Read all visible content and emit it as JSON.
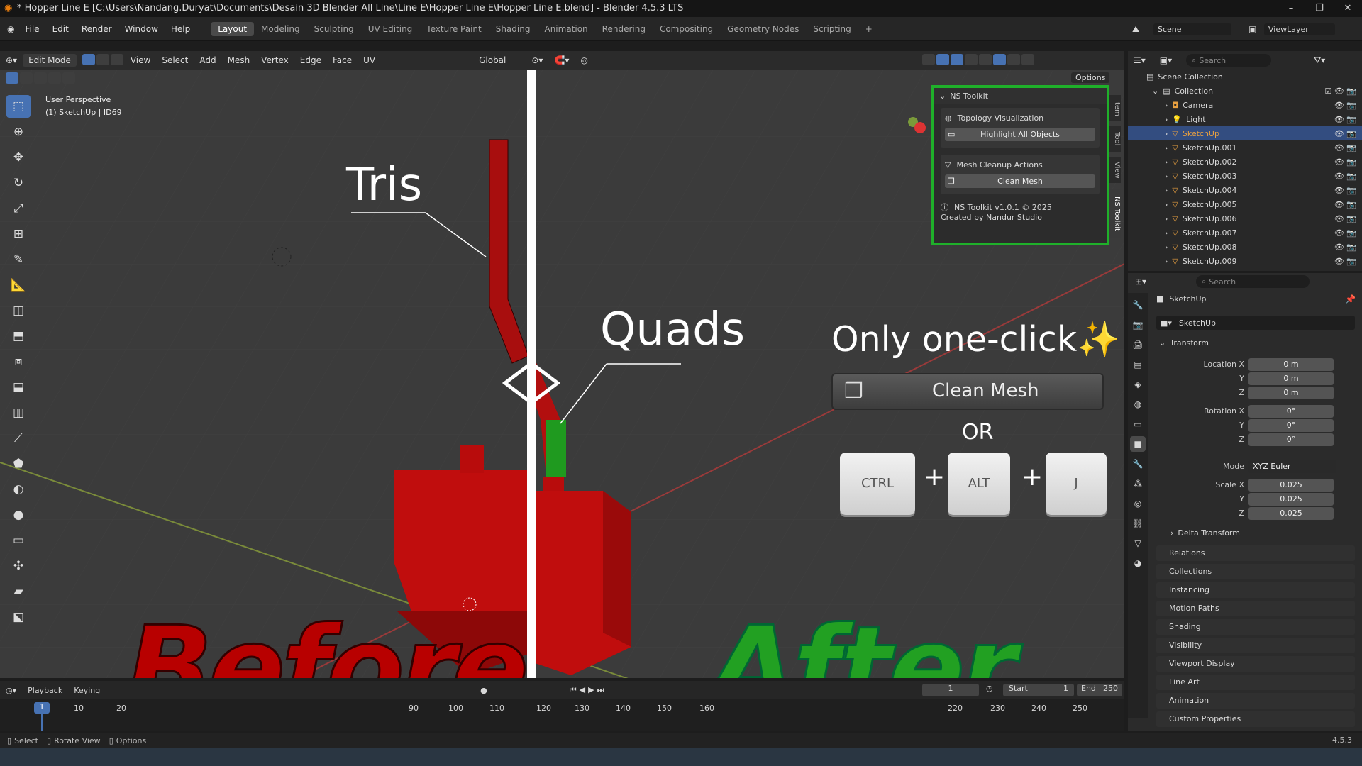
{
  "window": {
    "title": "* Hopper Line E [C:\\Users\\Nandang.Duryat\\Documents\\Desain 3D Blender All Line\\Line E\\Hopper Line E\\Hopper Line E.blend] - Blender 4.5.3 LTS",
    "minimize": "–",
    "maximize": "❐",
    "close": "✕"
  },
  "menu": [
    "File",
    "Edit",
    "Render",
    "Window",
    "Help"
  ],
  "workspaces": [
    "Layout",
    "Modeling",
    "Sculpting",
    "UV Editing",
    "Texture Paint",
    "Shading",
    "Animation",
    "Rendering",
    "Compositing",
    "Geometry Nodes",
    "Scripting"
  ],
  "workspace_add": "+",
  "scene": {
    "label": "Scene",
    "viewlayer": "ViewLayer"
  },
  "header": {
    "mode": "Edit Mode",
    "menus": [
      "View",
      "Select",
      "Add",
      "Mesh",
      "Vertex",
      "Edge",
      "Face",
      "UV"
    ],
    "orientation": "Global",
    "options": "Options"
  },
  "viewport": {
    "perspective": "User Perspective",
    "object": "(1) SketchUp | ID69",
    "label_tris": "Tris",
    "label_quads": "Quads",
    "label_before": "Before",
    "label_after": "After",
    "promo": "Only one-click✨",
    "clean_mesh_big": "Clean Mesh",
    "or": "OR",
    "keys": [
      "CTRL",
      "ALT",
      "J"
    ],
    "plus": "+"
  },
  "ns_toolkit": {
    "title": "NS Toolkit",
    "section1": "Topology Visualization",
    "button1": "Highlight All Objects",
    "section2": "Mesh Cleanup Actions",
    "button2": "Clean Mesh",
    "version": "NS Toolkit v1.0.1 © 2025",
    "credit": "Created by Nandur Studio"
  },
  "sidebar_tabs": [
    "Item",
    "Tool",
    "View",
    "NS Toolkit"
  ],
  "outliner": {
    "search_placeholder": "Search",
    "scene_collection": "Scene Collection",
    "collection": "Collection",
    "items": [
      "Camera",
      "Light",
      "SketchUp",
      "SketchUp.001",
      "SketchUp.002",
      "SketchUp.003",
      "SketchUp.004",
      "SketchUp.005",
      "SketchUp.006",
      "SketchUp.007",
      "SketchUp.008",
      "SketchUp.009"
    ],
    "selected": "SketchUp"
  },
  "properties": {
    "search_placeholder": "Search",
    "object_name": "SketchUp",
    "data_name": "SketchUp",
    "transform": "Transform",
    "location_label": "Location X",
    "location": [
      "0 m",
      "0 m",
      "0 m"
    ],
    "rotation_label": "Rotation X",
    "rotation": [
      "0°",
      "0°",
      "0°"
    ],
    "mode_label": "Mode",
    "mode": "XYZ Euler",
    "scale_label": "Scale X",
    "scale": [
      "0.025",
      "0.025",
      "0.025"
    ],
    "axis_y": "Y",
    "axis_z": "Z",
    "delta": "Delta Transform",
    "panels": [
      "Relations",
      "Collections",
      "Instancing",
      "Motion Paths",
      "Shading",
      "Visibility",
      "Viewport Display",
      "Line Art",
      "Animation",
      "Custom Properties"
    ]
  },
  "timeline": {
    "playback": "Playback",
    "keying": "Keying",
    "current_frame": "1",
    "frame_box": "1",
    "start_label": "Start",
    "start": "1",
    "end_label": "End",
    "end": "250",
    "ticks": [
      "10",
      "20",
      "90",
      "100",
      "110",
      "120",
      "130",
      "140",
      "150",
      "160",
      "220",
      "230",
      "240",
      "250"
    ]
  },
  "status": {
    "select": "Select",
    "rotate": "Rotate View",
    "options": "Options",
    "version": "4.5.3"
  },
  "colors": {
    "accent": "#4772b3",
    "ns_border": "#1fb02a",
    "before": "#c00000",
    "after": "#22a022"
  }
}
